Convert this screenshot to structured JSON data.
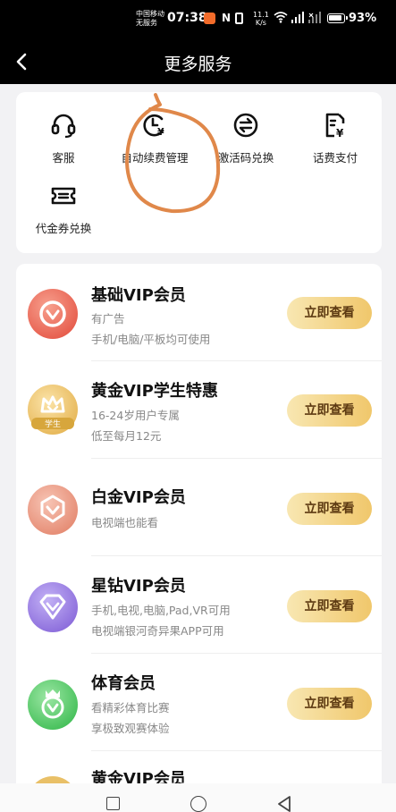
{
  "status_bar": {
    "carrier_line1": "中国移动",
    "carrier_line2": "无服务",
    "time": "07:38",
    "nfc": "N",
    "speed_value": "11.1",
    "speed_unit": "K/s",
    "signal_4g": "4G",
    "battery_percent": "93%"
  },
  "header": {
    "title": "更多服务",
    "back_icon": "chevron-left-icon"
  },
  "services": [
    {
      "label": "客服",
      "icon": "headset-icon"
    },
    {
      "label": "自动续费管理",
      "icon": "clock-yuan-icon"
    },
    {
      "label": "激活码兑换",
      "icon": "exchange-icon"
    },
    {
      "label": "话费支付",
      "icon": "phone-bill-icon"
    },
    {
      "label": "代金券兑换",
      "icon": "ticket-icon"
    }
  ],
  "vip_list": [
    {
      "title": "基础VIP会员",
      "lines": [
        "有广告",
        "手机/电脑/平板均可使用"
      ],
      "button": "立即查看",
      "badge_color": "#ee6a5a"
    },
    {
      "title": "黄金VIP学生特惠",
      "lines": [
        "16-24岁用户专属",
        "低至每月12元"
      ],
      "button": "立即查看",
      "badge_color": "#e9c067",
      "badge_tag": "学生"
    },
    {
      "title": "白金VIP会员",
      "lines": [
        "电视端也能看"
      ],
      "button": "立即查看",
      "badge_color": "#e9907a"
    },
    {
      "title": "星钻VIP会员",
      "lines": [
        "手机,电视,电脑,Pad,VR可用",
        "电视端银河奇异果APP可用"
      ],
      "button": "立即查看",
      "badge_color": "#9a80e0"
    },
    {
      "title": "体育会员",
      "lines": [
        "看精彩体育比赛",
        "享极致观赛体验"
      ],
      "button": "立即查看",
      "badge_color": "#5ccc6e"
    },
    {
      "title": "黄金VIP会员",
      "lines": [],
      "button": "",
      "badge_color": "#e9c067"
    }
  ],
  "colors": {
    "header_bg": "#000000",
    "page_bg": "#f2f2f4",
    "button_gradient_start": "#f8e7b2",
    "button_gradient_end": "#f0c76b",
    "button_text": "#5d3a12",
    "annotation_stroke": "#e0884a"
  },
  "nav_bar": {
    "icons": [
      "square-recents-icon",
      "circle-home-icon",
      "triangle-back-icon"
    ]
  }
}
